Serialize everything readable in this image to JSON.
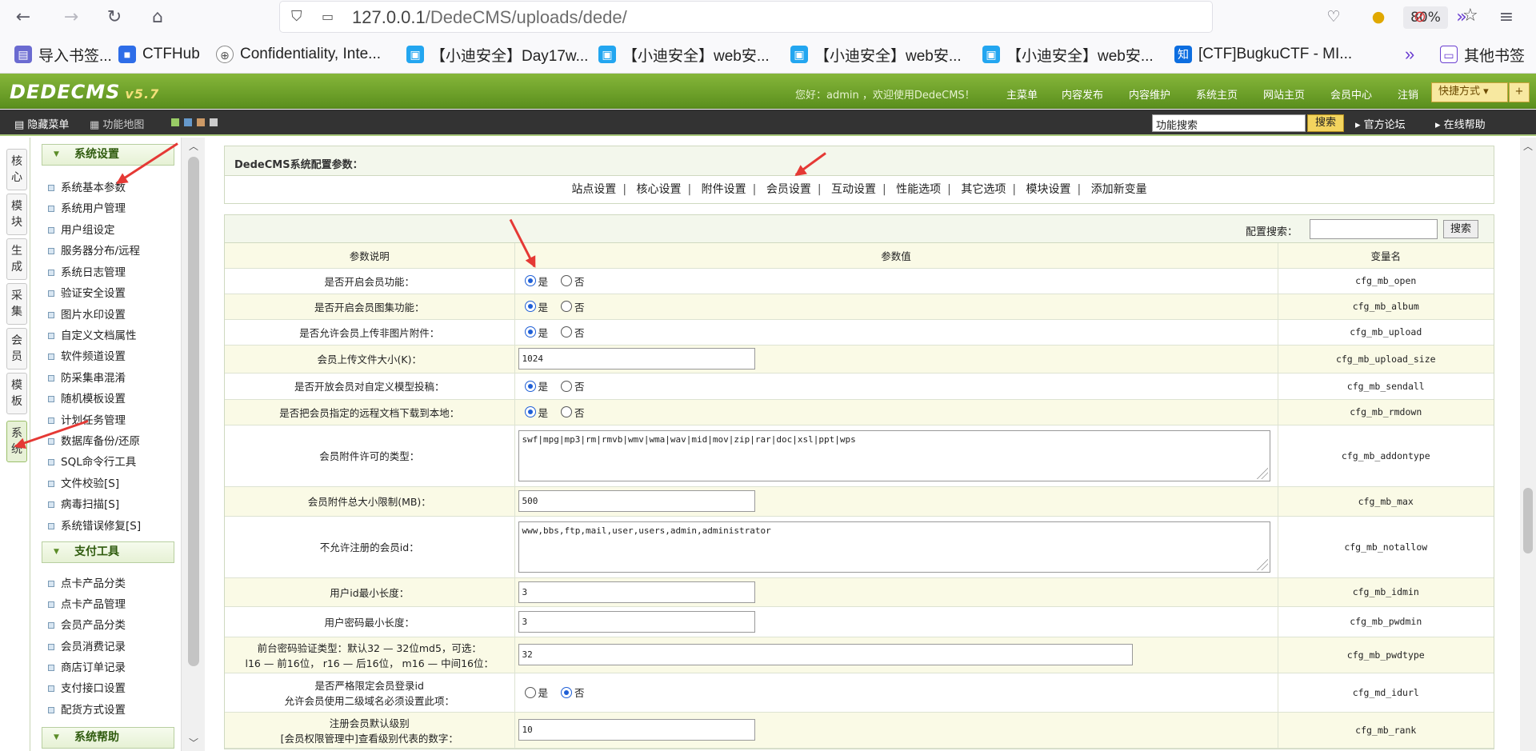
{
  "browser": {
    "url_host": "127.0.0.1",
    "url_path": "/DedeCMS/uploads/dede/",
    "zoom": "80%",
    "bookmarks": [
      "导入书签...",
      "CTFHub",
      "Confidentiality, Inte...",
      "【小迪安全】Day17w...",
      "【小迪安全】web安...",
      "【小迪安全】web安...",
      "【小迪安全】web安...",
      "[CTF]BugkuCTF - MI...",
      "其他书签"
    ]
  },
  "header": {
    "logo": "DEDECMS",
    "version": "v5.7",
    "welcome": "您好：admin ，欢迎使用DedeCMS！",
    "links": [
      "主菜单",
      "内容发布",
      "内容维护",
      "系统主页",
      "网站主页",
      "会员中心",
      "注销"
    ],
    "quick": "快捷方式"
  },
  "toolbar": {
    "hide_menu": "隐藏菜单",
    "func_map": "功能地图",
    "search_value": "功能搜索",
    "search_btn": "搜索",
    "forum": "官方论坛",
    "help": "在线帮助"
  },
  "left_tabs": [
    "核心",
    "模块",
    "生成",
    "采集",
    "会员",
    "模板",
    "系统"
  ],
  "sidemenu": {
    "sections": [
      {
        "title": "系统设置",
        "items": [
          "系统基本参数",
          "系统用户管理",
          "用户组设定",
          "服务器分布/远程",
          "系统日志管理",
          "验证安全设置",
          "图片水印设置",
          "自定义文档属性",
          "软件频道设置",
          "防采集串混淆",
          "随机模板设置",
          "计划任务管理",
          "数据库备份/还原",
          "SQL命令行工具",
          "文件校验[S]",
          "病毒扫描[S]",
          "系统错误修复[S]"
        ]
      },
      {
        "title": "支付工具",
        "items": [
          "点卡产品分类",
          "点卡产品管理",
          "会员产品分类",
          "会员消费记录",
          "商店订单记录",
          "支付接口设置",
          "配货方式设置"
        ]
      },
      {
        "title": "系统帮助",
        "items": []
      }
    ]
  },
  "main": {
    "title": "DedeCMS系统配置参数：",
    "tabs": [
      "站点设置",
      "核心设置",
      "附件设置",
      "会员设置",
      "互动设置",
      "性能选项",
      "其它选项",
      "模块设置",
      "添加新变量"
    ],
    "search_label": "配置搜索：",
    "search_btn": "搜索",
    "headers": [
      "参数说明",
      "参数值",
      "变量名"
    ],
    "yes": "是",
    "no": "否",
    "rows": [
      {
        "desc": "是否开启会员功能：",
        "var": "cfg_mb_open"
      },
      {
        "desc": "是否开启会员图集功能：",
        "var": "cfg_mb_album"
      },
      {
        "desc": "是否允许会员上传非图片附件：",
        "var": "cfg_mb_upload"
      },
      {
        "desc": "会员上传文件大小(K)：",
        "value": "1024",
        "var": "cfg_mb_upload_size"
      },
      {
        "desc": "是否开放会员对自定义模型投稿：",
        "var": "cfg_mb_sendall"
      },
      {
        "desc": "是否把会员指定的远程文档下载到本地：",
        "var": "cfg_mb_rmdown"
      },
      {
        "desc": "会员附件许可的类型：",
        "value": "swf|mpg|mp3|rm|rmvb|wmv|wma|wav|mid|mov|zip|rar|doc|xsl|ppt|wps",
        "var": "cfg_mb_addontype"
      },
      {
        "desc": "会员附件总大小限制(MB)：",
        "value": "500",
        "var": "cfg_mb_max"
      },
      {
        "desc": "不允许注册的会员id：",
        "value": "www,bbs,ftp,mail,user,users,admin,administrator",
        "var": "cfg_mb_notallow"
      },
      {
        "desc": "用户id最小长度：",
        "value": "3",
        "var": "cfg_mb_idmin"
      },
      {
        "desc": "用户密码最小长度：",
        "value": "3",
        "var": "cfg_mb_pwdmin"
      },
      {
        "desc1": "前台密码验证类型：默认32 — 32位md5，可选：",
        "desc2": "l16 — 前16位， r16 — 后16位， m16 — 中间16位：",
        "value": "32",
        "var": "cfg_mb_pwdtype"
      },
      {
        "desc1": "是否严格限定会员登录id",
        "desc2": "允许会员使用二级域名必须设置此项：",
        "var": "cfg_md_idurl"
      },
      {
        "desc1": "注册会员默认级别",
        "desc2": "[会员权限管理中]查看级别代表的数字：",
        "value": "10",
        "var": "cfg_mb_rank"
      }
    ]
  }
}
